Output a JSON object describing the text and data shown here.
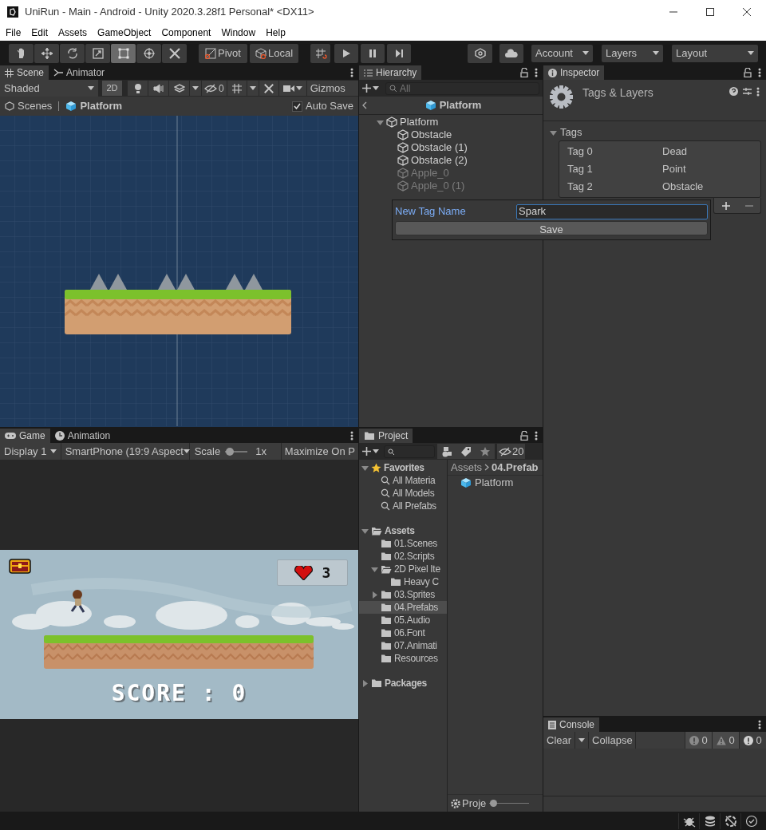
{
  "window": {
    "title": "UniRun - Main - Android - Unity 2020.3.28f1 Personal* <DX11>"
  },
  "menu": [
    "File",
    "Edit",
    "Assets",
    "GameObject",
    "Component",
    "Window",
    "Help"
  ],
  "toolbar": {
    "tools": [
      {
        "kind": "hand",
        "selected": false
      },
      {
        "kind": "move",
        "selected": false
      },
      {
        "kind": "rotate",
        "selected": false
      },
      {
        "kind": "scale",
        "selected": false
      },
      {
        "kind": "rect",
        "selected": true
      },
      {
        "kind": "transform",
        "selected": false
      },
      {
        "kind": "custom",
        "selected": false
      }
    ],
    "pivot": "Pivot",
    "local": "Local",
    "account": "Account",
    "layers": "Layers",
    "layout": "Layout"
  },
  "scene_panel": {
    "tabs": [
      {
        "label": "Scene",
        "selected": true
      },
      {
        "label": "Animator",
        "selected": false
      }
    ],
    "shading": "Shaded",
    "mode_2d": {
      "label": "2D",
      "selected": true
    },
    "hidden_count": "0",
    "gizmos": "Gizmos",
    "breadcrumb": [
      "Scenes",
      "Platform"
    ],
    "auto_save": {
      "label": "Auto Save",
      "checked": true
    }
  },
  "hierarchy": {
    "tab": "Hierarchy",
    "search_placeholder": "All",
    "header": "Platform",
    "tree": [
      {
        "label": "Platform",
        "active": true,
        "expanded": true,
        "children": [
          {
            "label": "Obstacle",
            "active": true
          },
          {
            "label": "Obstacle (1)",
            "active": true
          },
          {
            "label": "Obstacle (2)",
            "active": true
          },
          {
            "label": "Apple_0",
            "active": false
          },
          {
            "label": "Apple_0 (1)",
            "active": false
          }
        ]
      }
    ]
  },
  "inspector": {
    "tab": "Inspector",
    "header": "Tags & Layers",
    "section": {
      "label": "Tags",
      "expanded": true
    },
    "tags": [
      {
        "label": "Tag 0",
        "value": "Dead"
      },
      {
        "label": "Tag 1",
        "value": "Point"
      },
      {
        "label": "Tag 2",
        "value": "Obstacle"
      }
    ]
  },
  "new_tag_popup": {
    "label": "New Tag Name",
    "value": "Spark",
    "button": "Save"
  },
  "game_panel": {
    "tabs": [
      {
        "label": "Game",
        "selected": true
      },
      {
        "label": "Animation",
        "selected": false
      }
    ],
    "display": "Display 1",
    "aspect": "SmartPhone (19:9 Aspect",
    "scale_label": "Scale",
    "scale": {
      "level": 0.05
    },
    "scale_value": "1x",
    "maximize": "Maximize On P",
    "lives": "3",
    "score": "SCORE : 0"
  },
  "project": {
    "tab": "Project",
    "hidden_count": "20",
    "tree": [
      {
        "label": "Favorites",
        "kind": "favorites",
        "expanded": true,
        "children": [
          {
            "label": "All Materia",
            "kind": "search"
          },
          {
            "label": "All Models",
            "kind": "search"
          },
          {
            "label": "All Prefabs",
            "kind": "search"
          }
        ]
      },
      {
        "label": "Assets",
        "kind": "root",
        "expanded": true,
        "children": [
          {
            "label": "01.Scenes",
            "kind": "folder",
            "selected": false
          },
          {
            "label": "02.Scripts",
            "kind": "folder",
            "selected": false
          },
          {
            "label": "2D Pixel Ite",
            "kind": "folder",
            "selected": false,
            "expanded": true,
            "children": [
              {
                "label": "Heavy C",
                "kind": "folder",
                "selected": false
              }
            ]
          },
          {
            "label": "03.Sprites",
            "kind": "folder",
            "selected": false,
            "expanded": false
          },
          {
            "label": "04.Prefabs",
            "kind": "folder",
            "selected": true
          },
          {
            "label": "05.Audio",
            "kind": "folder",
            "selected": false
          },
          {
            "label": "06.Font",
            "kind": "folder",
            "selected": false
          },
          {
            "label": "07.Animati",
            "kind": "folder",
            "selected": false
          },
          {
            "label": "Resources",
            "kind": "folder",
            "selected": false
          }
        ]
      },
      {
        "label": "Packages",
        "kind": "root",
        "expanded": false
      }
    ],
    "breadcrumb": [
      "Assets",
      "04.Prefab"
    ],
    "items": [
      "Platform"
    ],
    "footer": "Proje",
    "zoom": {
      "level": 0.02
    }
  },
  "console": {
    "tab": "Console",
    "clear": "Clear",
    "collapse": "Collapse",
    "counts": [
      {
        "kind": "info",
        "count": "0"
      },
      {
        "kind": "warning",
        "count": "0"
      },
      {
        "kind": "error",
        "count": "0"
      }
    ]
  }
}
